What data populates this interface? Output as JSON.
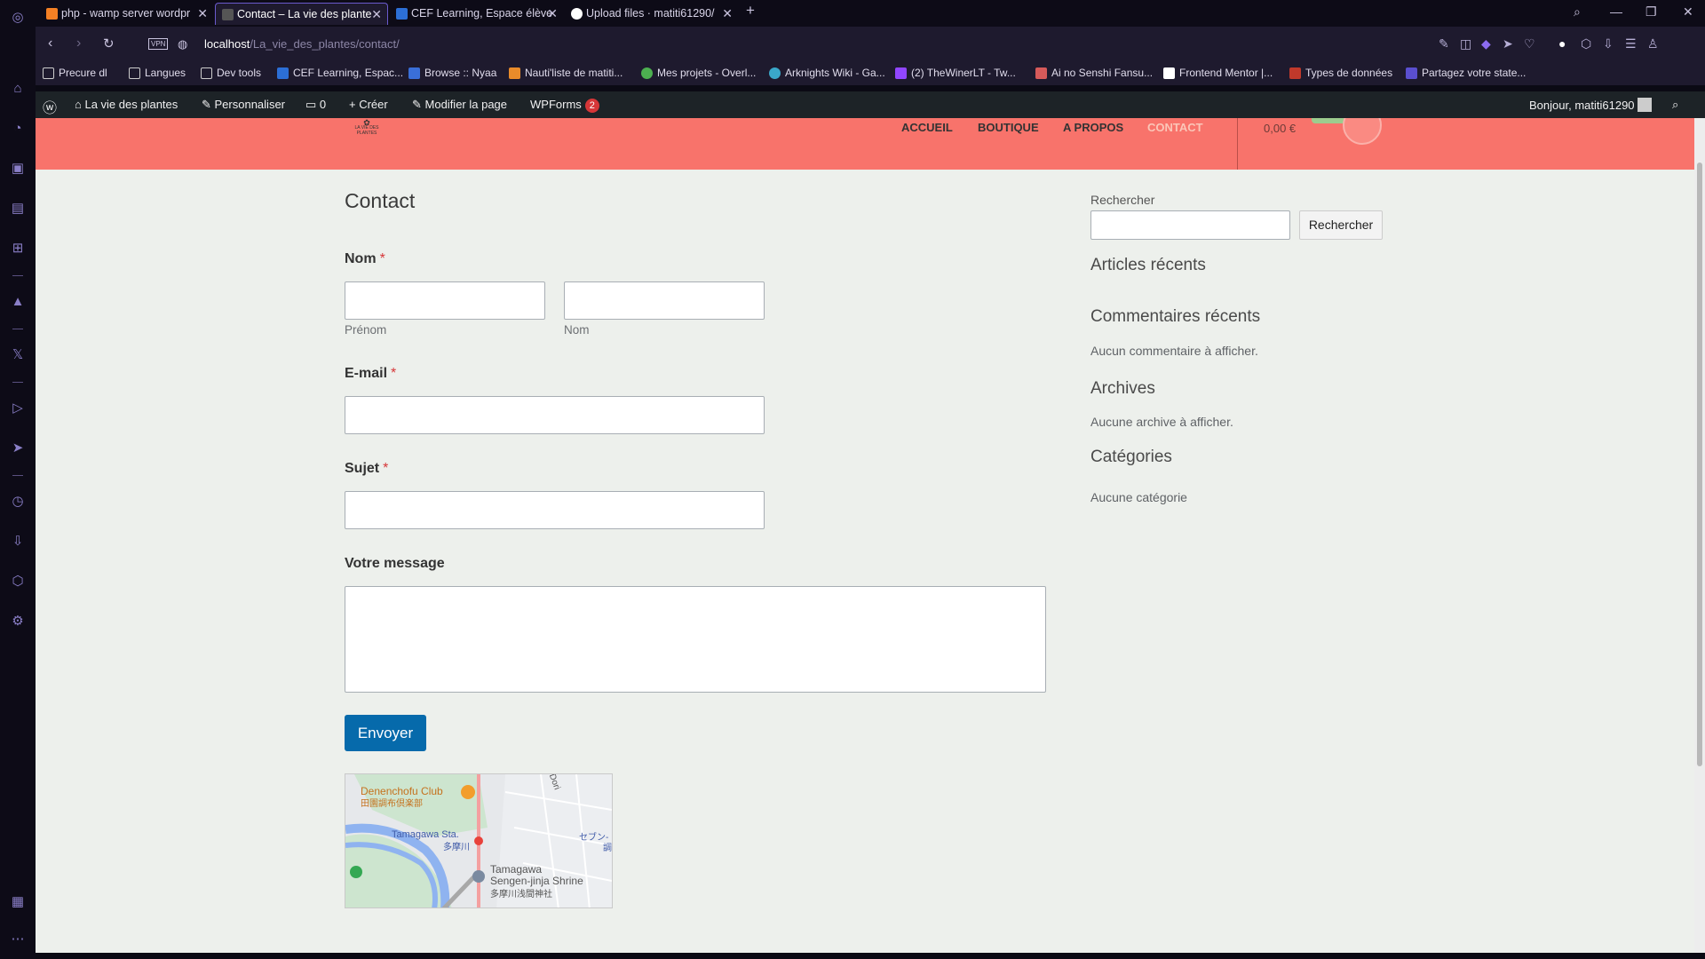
{
  "browser": {
    "tabs": [
      {
        "label": "php - wamp server wordpr",
        "favicon": "stackoverflow-icon"
      },
      {
        "label": "Contact – La vie des plante",
        "favicon": "page-icon",
        "active": true
      },
      {
        "label": "CEF Learning, Espace élève",
        "favicon": "cef-icon"
      },
      {
        "label": "Upload files · matiti61290/",
        "favicon": "github-icon"
      }
    ],
    "new_tab": "+",
    "url_host": "localhost",
    "url_path": "/La_vie_des_plantes/contact/",
    "vpn_label": "VPN",
    "bookmarks": [
      "Precure dl",
      "Langues",
      "Dev tools",
      "CEF Learning, Espac...",
      "Browse :: Nyaa",
      "Nauti'liste de matiti...",
      "Mes projets - Overl...",
      "Arknights Wiki - Ga...",
      "(2) TheWinerLT - Tw...",
      "Ai no Senshi Fansu...",
      "Frontend Mentor |...",
      "Types de données",
      "Partagez votre state..."
    ]
  },
  "wp_admin": {
    "site_name": "La vie des plantes",
    "customize": "Personnaliser",
    "comments_count": "0",
    "create": "Créer",
    "edit_page": "Modifier la page",
    "wpforms": "WPForms",
    "wpforms_badge": "2",
    "greeting": "Bonjour, matiti61290"
  },
  "site": {
    "logo_text": "LA VIE DES PLANTES",
    "menu": [
      "ACCUEIL",
      "BOUTIQUE",
      "A PROPOS",
      "CONTACT"
    ],
    "cart_total": "0,00 €"
  },
  "form": {
    "title": "Contact",
    "name_label": "Nom",
    "req": "*",
    "first_sub": "Prénom",
    "last_sub": "Nom",
    "email_label": "E-mail",
    "subject_label": "Sujet",
    "message_label": "Votre message",
    "submit": "Envoyer"
  },
  "map": {
    "labels": [
      "Denenchofu Club",
      "田園調布倶楽部",
      "Tamagawa Sta.",
      "多摩川",
      "Tamagawa",
      "Sengen-jinja Shrine",
      "多摩川浅間神社",
      "Dori",
      "セブン-",
      "調"
    ]
  },
  "sidebar": {
    "search_label": "Rechercher",
    "search_button": "Rechercher",
    "recent_posts": "Articles récents",
    "recent_comments": "Commentaires récents",
    "no_comments": "Aucun commentaire à afficher.",
    "archives": "Archives",
    "no_archives": "Aucune archive à afficher.",
    "categories": "Catégories",
    "no_categories": "Aucune catégorie"
  },
  "colors": {
    "header": "#f8736b",
    "submit": "#066aab",
    "admin_bar": "#1d2327",
    "browser_accent": "#6a5acd"
  }
}
